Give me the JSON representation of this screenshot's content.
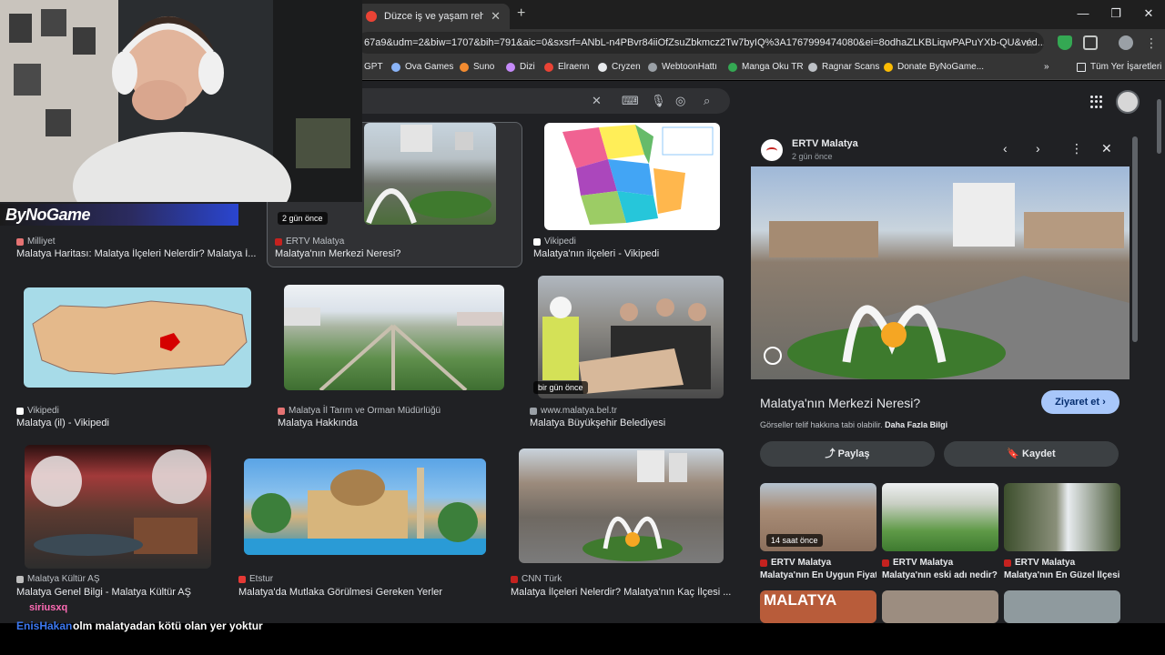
{
  "browser": {
    "tab_title": "Düzce iş ve yaşam rehberi",
    "url": "67a9&udm=2&biw=1707&bih=791&aic=0&sxsrf=ANbL-n4PBvr84iiOfZsuZbkmcz2Tw7byIQ%3A1767999474080&ei=8odhaZLKBLiqwPAPuYXb-QU&ved...",
    "bookmarks": [
      "GPT",
      "Ova Games",
      "Suno",
      "Dizi",
      "Elraenn",
      "Cryzen",
      "WebtoonHattı",
      "Manga Oku TR",
      "Ragnar Scans",
      "Donate ByNoGame...",
      "Tüm Yer İşaretleri"
    ]
  },
  "results": [
    {
      "source": "Milliyet",
      "caption": "Malatya Haritası: Malatya İlçeleri Nelerdir? Malatya İ..."
    },
    {
      "source": "ERTV Malatya",
      "caption": "Malatya'nın Merkezi Neresi?",
      "badge": "2 gün önce"
    },
    {
      "source": "Vikipedi",
      "caption": "Malatya'nın ilçeleri - Vikipedi"
    },
    {
      "source": "Vikipedi",
      "caption": "Malatya (il) - Vikipedi"
    },
    {
      "source": "Malatya İl Tarım ve Orman Müdürlüğü",
      "caption": "Malatya Hakkında"
    },
    {
      "source": "www.malatya.bel.tr",
      "caption": "Malatya Büyükşehir Belediyesi",
      "badge": "bir gün önce"
    },
    {
      "source": "Malatya Kültür AŞ",
      "caption": "Malatya Genel Bilgi - Malatya Kültür AŞ"
    },
    {
      "source": "Etstur",
      "caption": "Malatya'da Mutlaka Görülmesi Gereken Yerler"
    },
    {
      "source": "CNN Türk",
      "caption": "Malatya İlçeleri Nelerdir? Malatya'nın Kaç İlçesi ..."
    }
  ],
  "panel": {
    "source": "ERTV Malatya",
    "time": "2 gün önce",
    "title": "Malatya'nın Merkezi Neresi?",
    "visit": "Ziyaret et",
    "copyright": "Görseller telif hakkına tabi olabilir.",
    "more_info": "Daha Fazla Bilgi",
    "share": "Paylaş",
    "save": "Kaydet",
    "related": [
      {
        "source": "ERTV Malatya",
        "caption": "Malatya'nın En Uygun Fiyatl...",
        "badge": "14 saat önce"
      },
      {
        "source": "ERTV Malatya",
        "caption": "Malatya'nın eski adı nedir?"
      },
      {
        "source": "ERTV Malatya",
        "caption": "Malatya'nın En Güzel İlçesi..."
      }
    ],
    "related_more_text": "MALATYA"
  },
  "stream": {
    "logo": "ByNoGame",
    "chat": [
      {
        "user": "siriusxq",
        "message": ""
      },
      {
        "user": "EnisHakan",
        "message": "olm malatyadan kötü olan yer yoktur"
      }
    ]
  }
}
